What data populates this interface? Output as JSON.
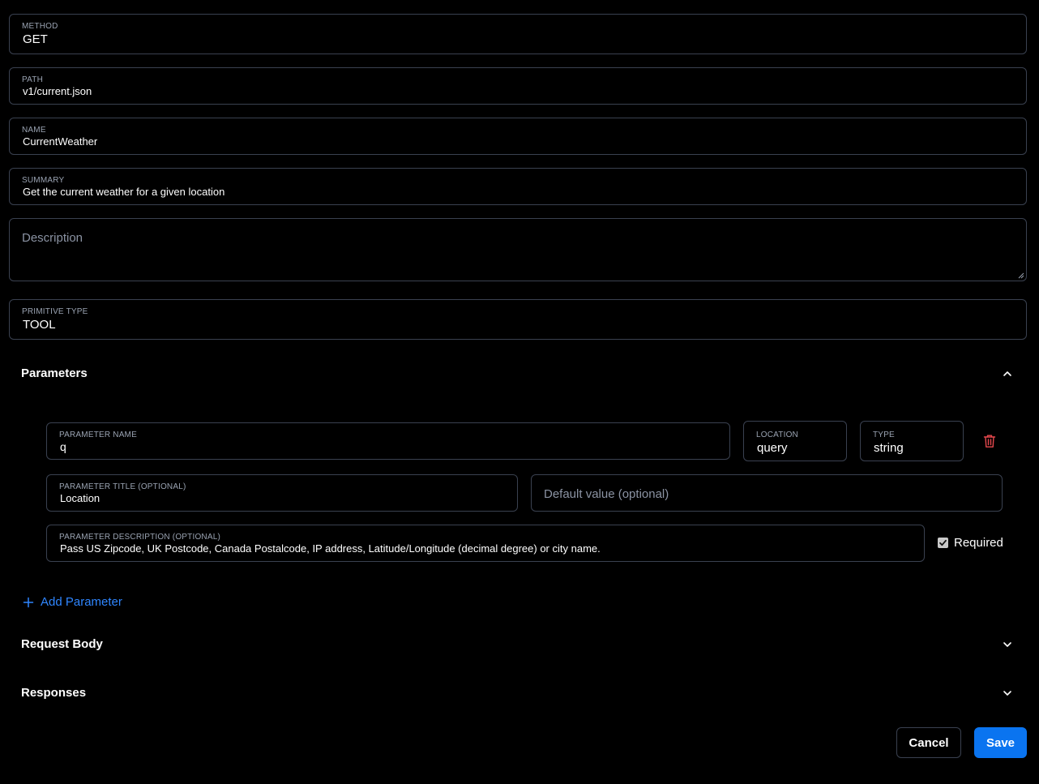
{
  "method": {
    "label": "METHOD",
    "value": "GET"
  },
  "path": {
    "label": "PATH",
    "value": "v1/current.json"
  },
  "name": {
    "label": "NAME",
    "value": "CurrentWeather"
  },
  "summary": {
    "label": "SUMMARY",
    "value": "Get the current weather for a given location"
  },
  "description": {
    "placeholder": "Description"
  },
  "primitive_type": {
    "label": "PRIMITIVE TYPE",
    "value": "TOOL"
  },
  "parameters": {
    "title": "Parameters",
    "expanded": true,
    "items": [
      {
        "name_label": "PARAMETER NAME",
        "name_value": "q",
        "location_label": "LOCATION",
        "location_value": "query",
        "type_label": "TYPE",
        "type_value": "string",
        "title_label": "PARAMETER TITLE (OPTIONAL)",
        "title_value": "Location",
        "default_placeholder": "Default value (optional)",
        "description_label": "PARAMETER DESCRIPTION (OPTIONAL)",
        "description_value": "Pass US Zipcode, UK Postcode, Canada Postalcode, IP address, Latitude/Longitude (decimal degree) or city name.",
        "required_label": "Required",
        "required": true
      }
    ],
    "add_label": "Add Parameter"
  },
  "request_body": {
    "title": "Request Body",
    "expanded": false
  },
  "responses": {
    "title": "Responses",
    "expanded": false
  },
  "actions": {
    "cancel_label": "Cancel",
    "save_label": "Save"
  },
  "colors": {
    "accent": "#0a74f0",
    "link": "#2f86ff",
    "danger": "#e5484d",
    "border": "#3a4150"
  },
  "icons": {
    "collapse": "chevron-up-icon",
    "expand": "chevron-down-icon",
    "delete": "trash-icon",
    "add": "plus-icon",
    "check": "checkbox-checked-icon"
  }
}
